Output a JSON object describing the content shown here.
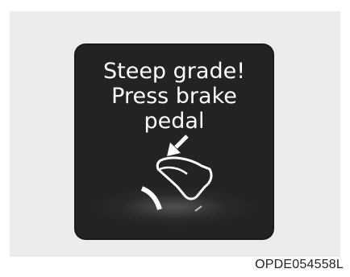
{
  "warning": {
    "lines": [
      "Steep grade!",
      "Press brake",
      "pedal"
    ],
    "icon": "brake-pedal-press-icon"
  },
  "figure_code": "OPDE054558L",
  "colors": {
    "screen_background": "#232323",
    "text": "#ffffff",
    "page_background": "#ececec"
  }
}
